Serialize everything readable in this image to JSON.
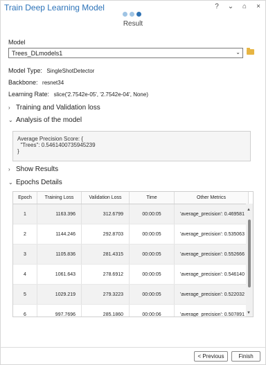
{
  "header": {
    "title": "Train Deep Learning Model",
    "icons": {
      "help": "?",
      "dropdown": "⌄",
      "dock": "⌂",
      "close": "×"
    },
    "step_label": "Result"
  },
  "model": {
    "label": "Model",
    "value": "Trees_DLmodels1"
  },
  "info": {
    "model_type_label": "Model Type:",
    "model_type_value": "SingleShotDetector",
    "backbone_label": "Backbone:",
    "backbone_value": "resnet34",
    "learning_rate_label": "Learning Rate:",
    "learning_rate_value": "slice('2.7542e-05', '2.7542e-04', None)"
  },
  "sections": {
    "training_validation": "Training and Validation loss",
    "analysis": "Analysis of the model",
    "show_results": "Show Results",
    "epochs_details": "Epochs Details"
  },
  "analysis": {
    "line1": "Average Precision Score: {",
    "line2": "  \"Trees\": 0.5461400735945239",
    "line3": "}"
  },
  "table": {
    "headers": [
      "Epoch",
      "Training Loss",
      "Validation Loss",
      "Time",
      "Other Metrics"
    ],
    "rows": [
      [
        "1",
        "1163.396",
        "312.6799",
        "00:00:05",
        "'average_precision': 0.469581"
      ],
      [
        "2",
        "1144.246",
        "292.8703",
        "00:00:05",
        "'average_precision': 0.535063"
      ],
      [
        "3",
        "1105.836",
        "281.4315",
        "00:00:05",
        "'average_precision': 0.552666"
      ],
      [
        "4",
        "1061.643",
        "278.6912",
        "00:00:05",
        "'average_precision': 0.546140"
      ],
      [
        "5",
        "1029.219",
        "279.3223",
        "00:00:05",
        "'average_precision': 0.522032"
      ],
      [
        "6",
        "997.7696",
        "285.1860",
        "00:00:06",
        "'average_precision': 0.507891"
      ]
    ]
  },
  "buttons": {
    "previous": "< Previous",
    "finish": "Finish"
  },
  "colors": {
    "accent": "#2f72b3",
    "accent_light": "#9fc4e4"
  }
}
